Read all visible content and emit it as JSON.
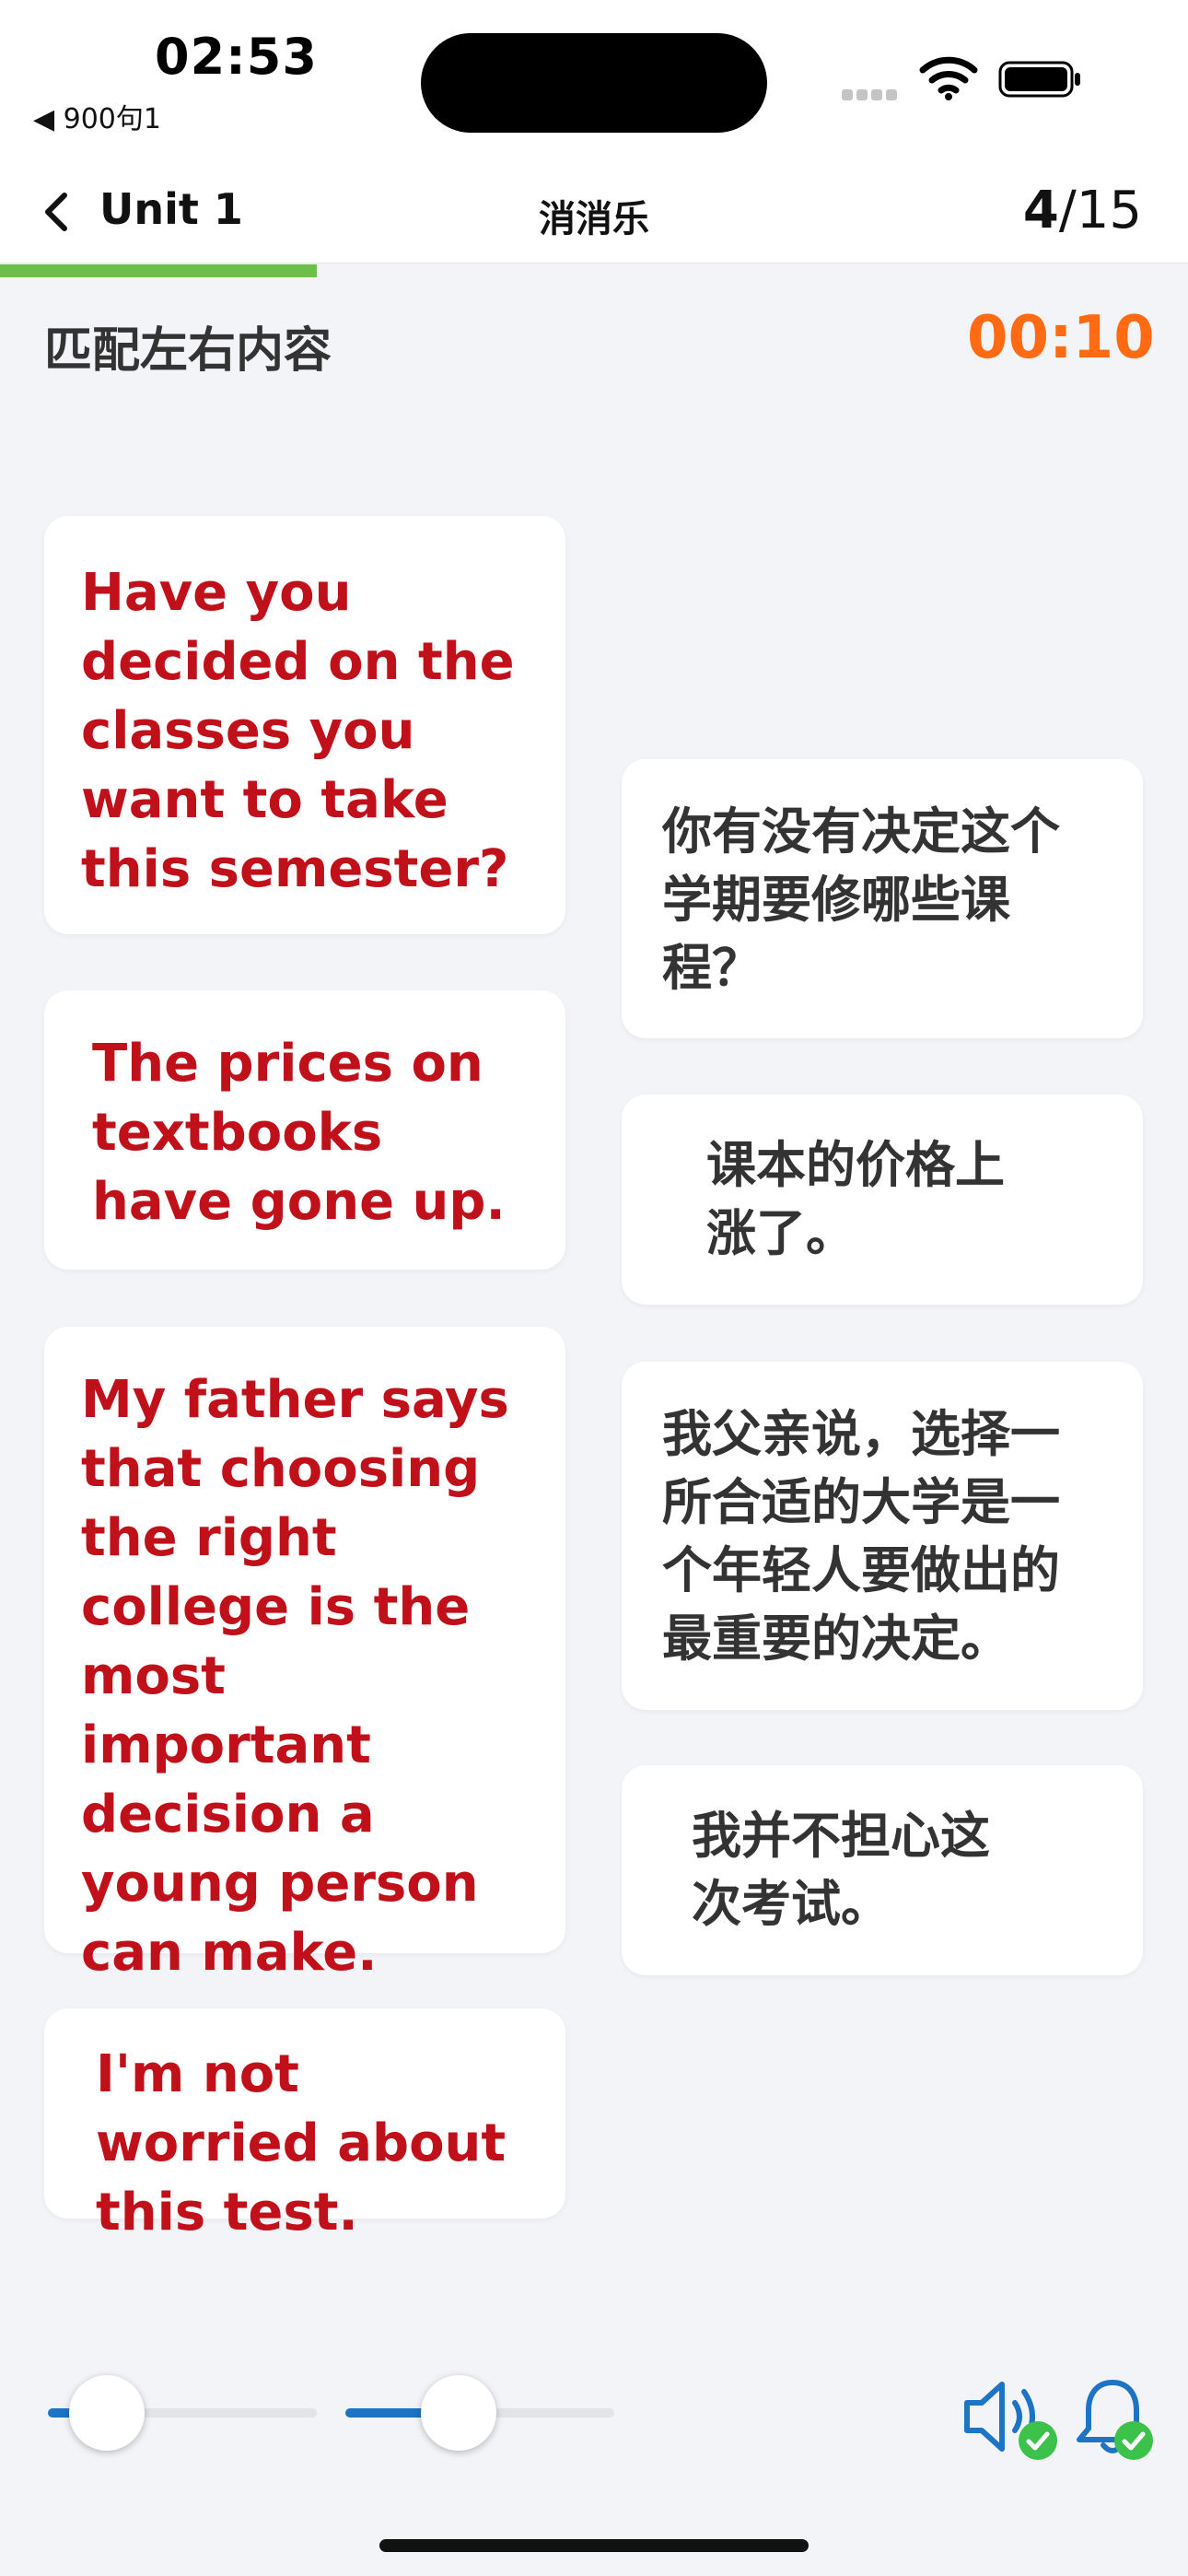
{
  "status_bar": {
    "time": "02:53",
    "back_app": "◀ 900句1"
  },
  "nav": {
    "back_label": "Unit 1",
    "title": "消消乐",
    "current": "4",
    "separator": "/",
    "total": "15",
    "progress_fraction": 0.2667
  },
  "instruction": "匹配左右内容",
  "timer": "00:10",
  "cards": {
    "left": [
      "Have you decided on the classes you want to take this semester?",
      "The prices on textbooks have gone up.",
      "My father says that choosing the right college is the most important decision a young person can make.",
      "I'm not worried about this test."
    ],
    "right": [
      "你有没有决定这个学期要修哪些课程？",
      "课本的价格上涨了。",
      "我父亲说，选择一所合适的大学是一个年轻人要做出的最重要的决定。",
      "我并不担心这次考试。"
    ]
  },
  "controls": {
    "slider1_value": 0.22,
    "slider2_value": 0.42,
    "speaker_icon": "speaker-icon",
    "bell_icon": "bell-icon"
  },
  "colors": {
    "accent_green": "#6cc04a",
    "timer_orange": "#ff6a13",
    "english_red": "#c0101a",
    "slider_blue": "#1d74c5"
  }
}
